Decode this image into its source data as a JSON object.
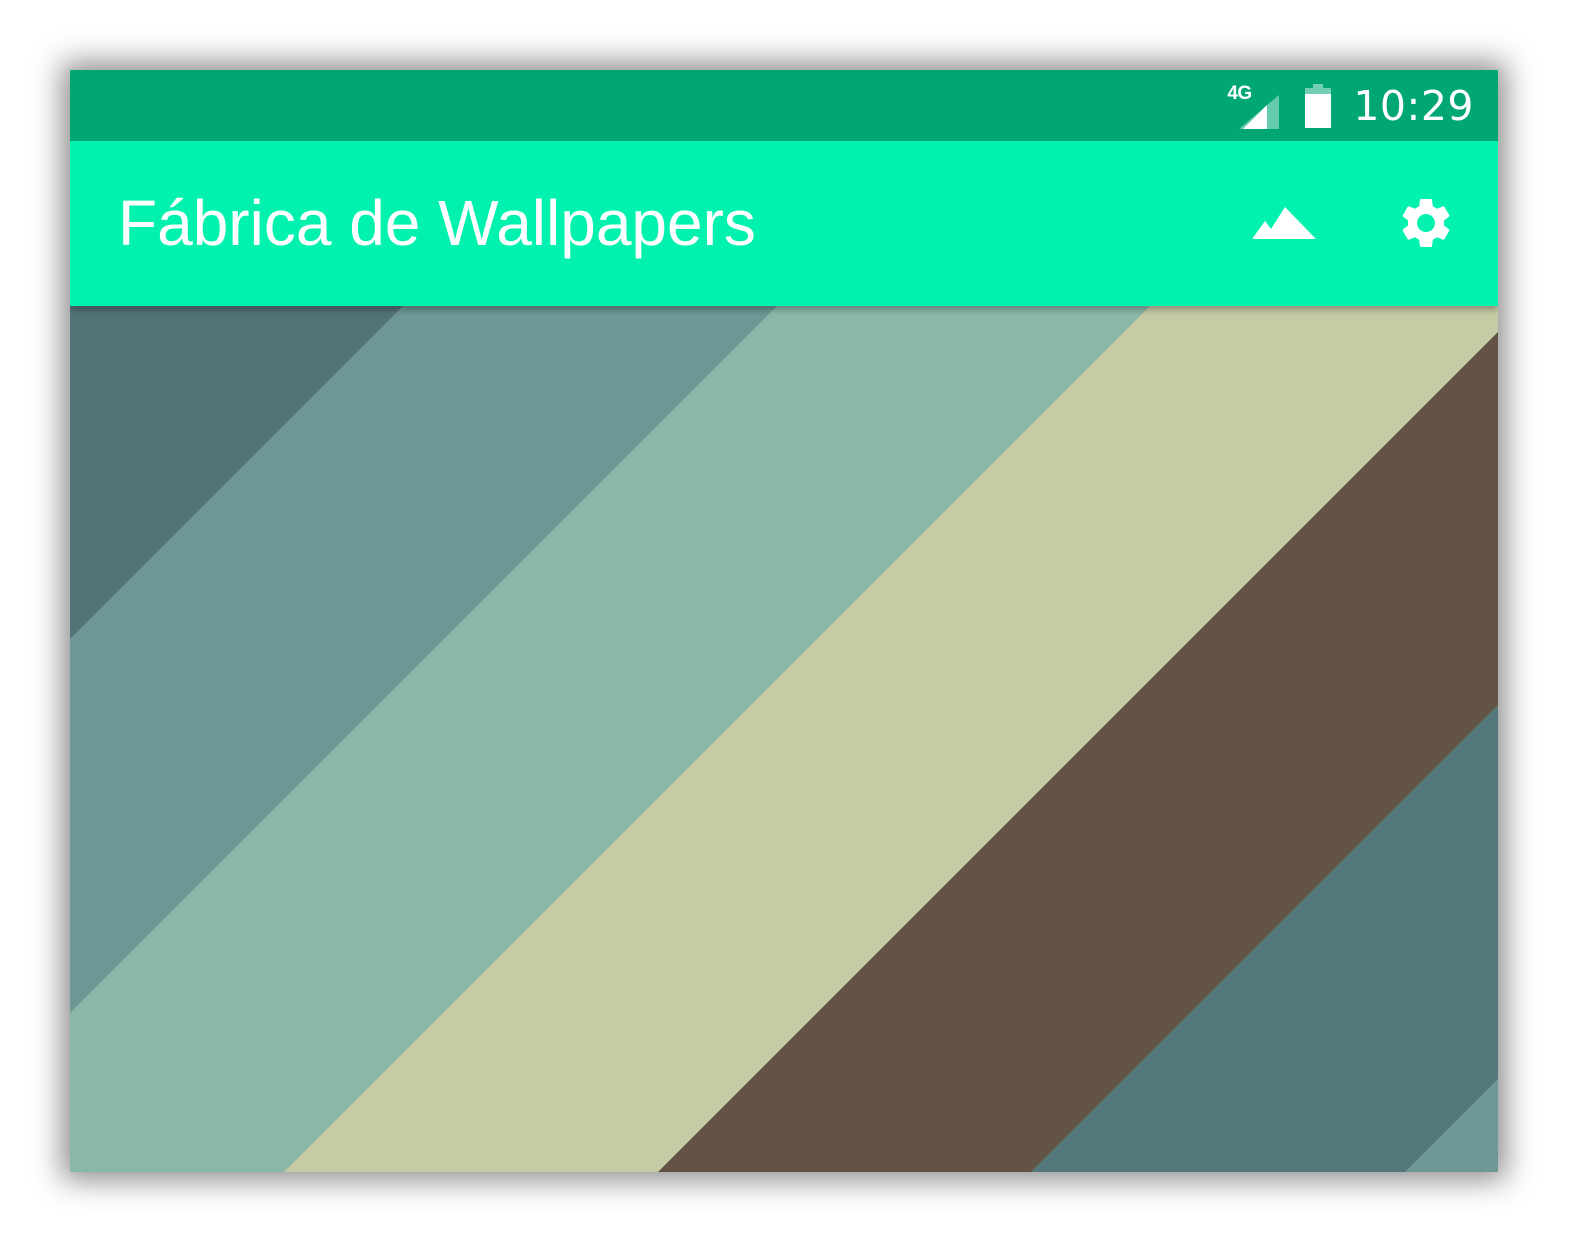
{
  "status_bar": {
    "network": "4G",
    "time": "10:29",
    "background": "#00a775"
  },
  "app_bar": {
    "title": "Fábrica de Wallpapers",
    "background": "#00f2ae",
    "actions": [
      {
        "name": "wallpaper",
        "icon": "landscape-icon"
      },
      {
        "name": "settings",
        "icon": "gear-icon"
      }
    ]
  },
  "wallpaper": {
    "pattern": "diagonal-stripes",
    "colors": [
      "#547379",
      "#6d9896",
      "#8ab8a8",
      "#c6cba5",
      "#625345",
      "#54777c",
      "#6d9896"
    ]
  }
}
